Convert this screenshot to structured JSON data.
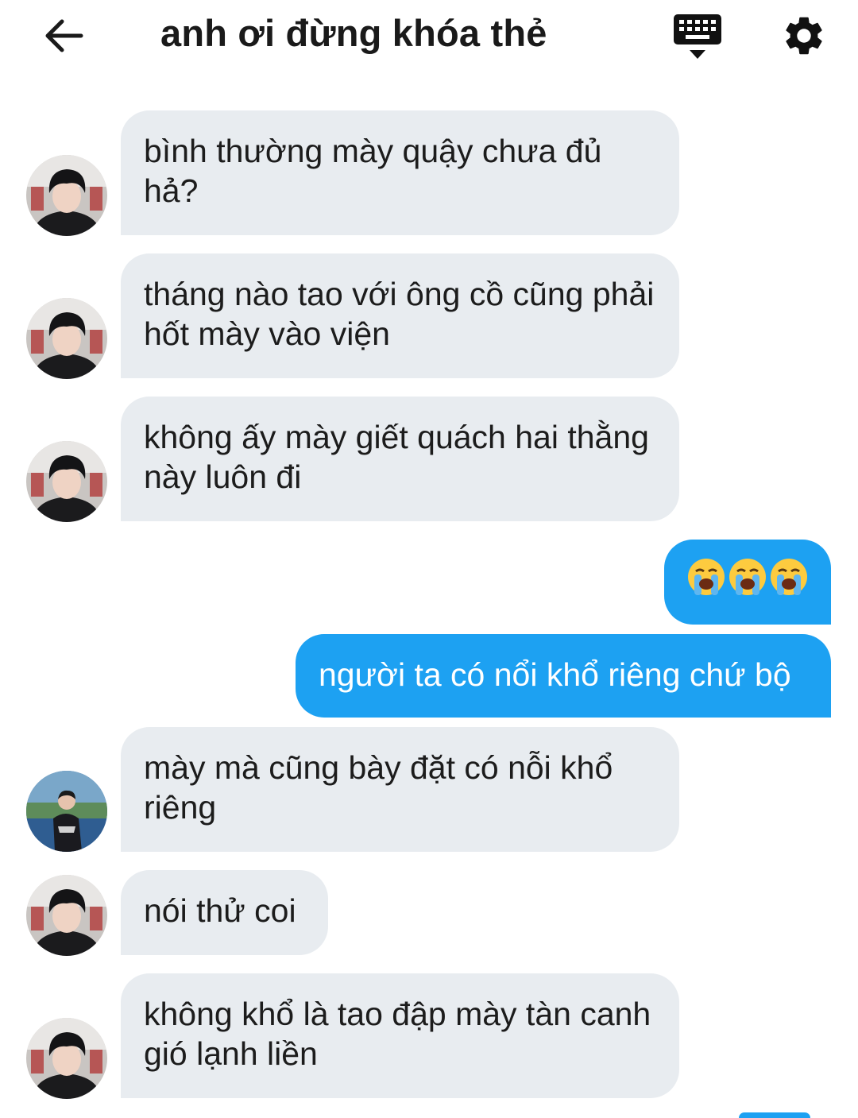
{
  "header": {
    "title": "anh ơi đừng khóa thẻ",
    "back_icon": "arrow-left-icon",
    "keyboard_icon": "keyboard-icon",
    "settings_icon": "gear-icon"
  },
  "colors": {
    "incoming_bubble": "#e8ecf0",
    "outgoing_bubble": "#1da1f2",
    "text": "#1c1c1c"
  },
  "messages": [
    {
      "direction": "incoming",
      "avatar": "avatar-a",
      "text": "bình thường mày quậy chưa đủ hả?"
    },
    {
      "direction": "incoming",
      "avatar": "avatar-a",
      "text": "tháng nào tao với ông cồ cũng phải hốt mày vào viện"
    },
    {
      "direction": "incoming",
      "avatar": "avatar-a",
      "text": "không ấy mày giết quách hai thằng này luôn đi"
    },
    {
      "direction": "outgoing",
      "emoji": [
        "😭",
        "😭",
        "😭"
      ],
      "emoji_name": "loudly-crying-face-icon"
    },
    {
      "direction": "outgoing",
      "text": "người ta có nổi khổ riêng chứ bộ"
    },
    {
      "direction": "incoming",
      "avatar": "avatar-b",
      "text": "mày mà cũng bày đặt có nỗi khổ riêng"
    },
    {
      "direction": "incoming",
      "avatar": "avatar-a",
      "text": "nói thử coi"
    },
    {
      "direction": "incoming",
      "avatar": "avatar-a",
      "text": "không khổ là tao đập mày tàn canh gió lạnh liền"
    }
  ]
}
